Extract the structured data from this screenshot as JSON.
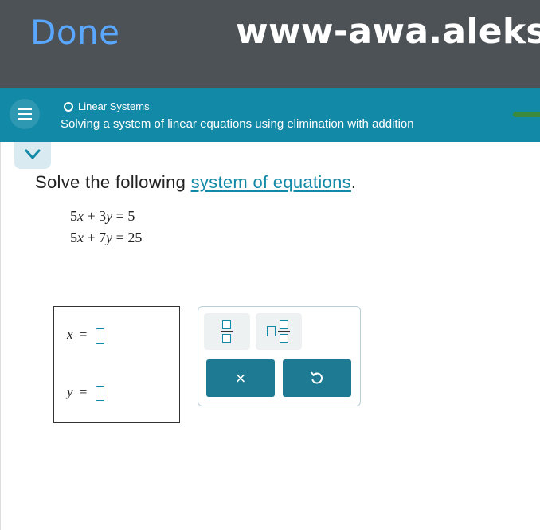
{
  "browser": {
    "done_label": "Done",
    "url": "www-awa.aleks"
  },
  "header": {
    "topic": "Linear Systems",
    "subtitle": "Solving a system of linear equations using elimination with addition",
    "progress_color": "#3c8a3c"
  },
  "question": {
    "instruction_prefix": "Solve the following ",
    "instruction_link": "system of equations",
    "instruction_suffix": ".",
    "equations": [
      {
        "a": "5",
        "v1": "x",
        "op": "+",
        "b": "3",
        "v2": "y",
        "eq": "=",
        "rhs": "5"
      },
      {
        "a": "5",
        "v1": "x",
        "op": "+",
        "b": "7",
        "v2": "y",
        "eq": "=",
        "rhs": "25"
      }
    ]
  },
  "answer": {
    "x_label": "x",
    "y_label": "y",
    "equals": "=",
    "x_value": "",
    "y_value": ""
  },
  "palette": {
    "clear_symbol": "×",
    "undo_icon": "undo-icon",
    "fraction_icon": "fraction-icon",
    "mixed_number_icon": "mixed-number-icon"
  },
  "colors": {
    "header_bg": "#1289a6",
    "browser_bar_bg": "#4d5256",
    "done_color": "#5aa7ff",
    "button_bg": "#1d7a92"
  }
}
